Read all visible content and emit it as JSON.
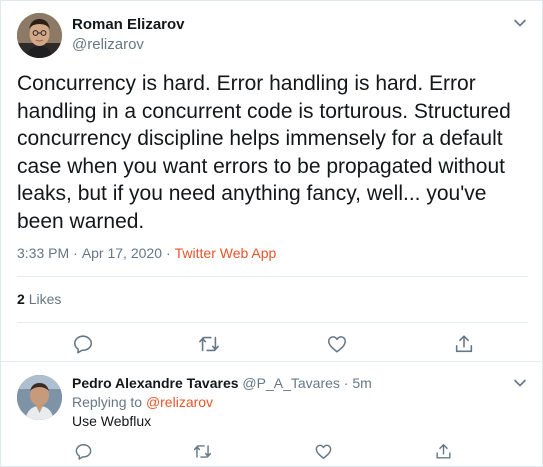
{
  "main_tweet": {
    "author_name": "Roman Elizarov",
    "author_handle": "@relizarov",
    "text": "Concurrency is hard. Error handling is hard. Error handling in a concurrent code is torturous. Structured concurrency discipline helps immensely for a default case when you want errors to be propagated without leaks, but if you need anything fancy, well... you've been warned.",
    "time": "3:33 PM",
    "date": "Apr 17, 2020",
    "separator": "·",
    "source": "Twitter Web App",
    "likes_count": "2",
    "likes_label": "Likes",
    "actions": [
      "reply-icon",
      "retweet-icon",
      "like-icon",
      "share-icon"
    ],
    "menu_icon": "chevron-down-icon"
  },
  "reply_tweet": {
    "author_name": "Pedro Alexandre Tavares",
    "author_handle": "@P_A_Tavares",
    "separator": "·",
    "time_ago": "5m",
    "replying_prefix": "Replying to",
    "replying_to": "@relizarov",
    "text": "Use Webflux",
    "actions": [
      "reply-icon",
      "retweet-icon",
      "like-icon",
      "share-icon"
    ],
    "menu_icon": "chevron-down-icon"
  },
  "colors": {
    "text": "#14171a",
    "secondary": "#657786",
    "accent": "#e8542a",
    "border": "#e6ecf0"
  }
}
